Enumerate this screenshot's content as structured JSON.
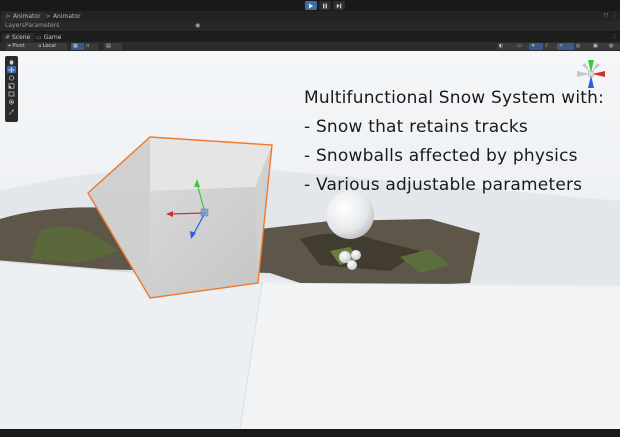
{
  "toolbar_top": {
    "play": "play-icon",
    "pause": "pause-icon",
    "step": "step-icon"
  },
  "animator_tabs": [
    {
      "label": "Animator",
      "icon": "animator-icon"
    },
    {
      "label": "Animator",
      "icon": "animator-icon"
    }
  ],
  "animator_subtabs": [
    {
      "label": "Layers"
    },
    {
      "label": "Parameters"
    }
  ],
  "scene_tabs": [
    {
      "label": "Scene",
      "icon": "scene-icon"
    },
    {
      "label": "Game",
      "icon": "game-icon"
    }
  ],
  "scene_toolbar": {
    "pivot_label": "Pivot",
    "local_label": "Local"
  },
  "overlay": {
    "line1": "Multifunctional Snow System with:",
    "line2": "- Snow that retains tracks",
    "line3": "- Snowballs affected by physics",
    "line4": "- Various adjustable parameters"
  },
  "colors": {
    "editor_bg": "#191919",
    "accent_blue": "#3a6ea8",
    "selection_outline": "#f07a2c",
    "snow": "#eef1f4"
  }
}
